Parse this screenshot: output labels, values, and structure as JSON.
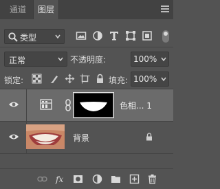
{
  "tabs": [
    {
      "label": "通道"
    },
    {
      "label": "图层"
    }
  ],
  "filter": {
    "kind_label": "类型",
    "icons": [
      "image-filter-icon",
      "adjustment-filter-icon",
      "type-filter-icon",
      "shape-filter-icon",
      "smart-object-filter-icon"
    ]
  },
  "blend": {
    "mode": "正常",
    "opacity_label": "不透明度:",
    "opacity_value": "100%"
  },
  "lock": {
    "label": "锁定:",
    "fill_label": "填充:",
    "fill_value": "100%"
  },
  "layers": [
    {
      "name": "色相... 1",
      "kind": "adjustment",
      "visible": true,
      "selected": true
    },
    {
      "name": "背景",
      "kind": "image",
      "visible": true,
      "locked": true
    }
  ],
  "bottom_icons": [
    "link-layers-icon",
    "fx-icon",
    "add-mask-icon",
    "new-adjustment-icon",
    "new-group-icon",
    "new-layer-icon",
    "delete-icon"
  ],
  "colors": {
    "panel": "#535353",
    "selected_layer": "#6b6b6b",
    "tabbar": "#424242"
  }
}
